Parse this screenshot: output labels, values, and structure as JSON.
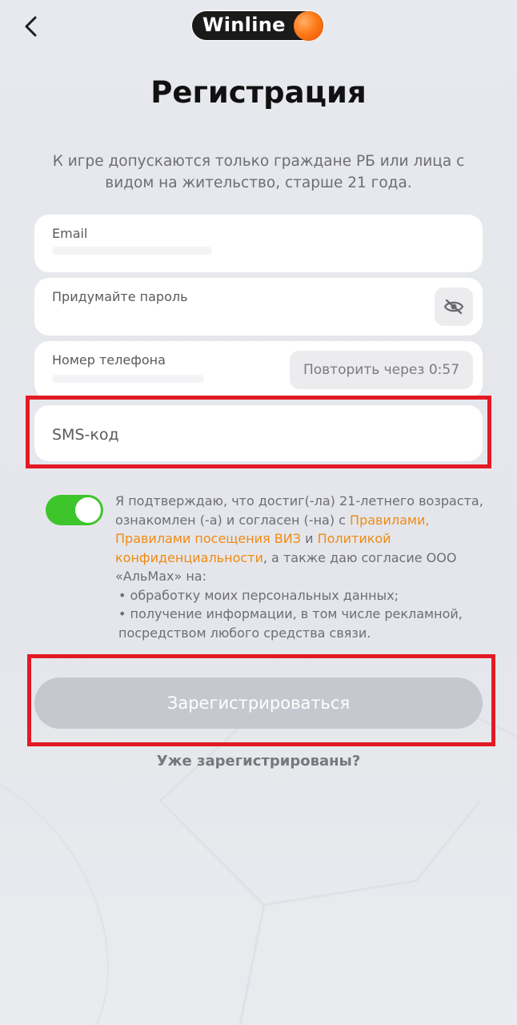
{
  "header": {
    "back_icon": "chevron-left-icon",
    "logo_text": "Winline",
    "logo_ball_color": "#ff7a1a"
  },
  "title": "Регистрация",
  "subtitle": "К игре допускаются только граждане РБ или лица с видом на жительство, старше 21 года.",
  "form": {
    "email_label": "Email",
    "password_label": "Придумайте пароль",
    "password_toggle_icon": "eye-off-icon",
    "phone_label": "Номер телефона",
    "resend_label": "Повторить через 0:57",
    "sms_placeholder": "SMS-код"
  },
  "consent": {
    "toggle_on": true,
    "text_1": "Я подтверждаю, что достиг(-ла) 21-летнего возраста, ознакомлен (-а) и согласен (-на) с ",
    "link_1": "Правилами, Правилами посещения ВИЗ",
    "text_2": " и ",
    "link_2": "Политикой конфиденциальности",
    "text_3": ",  а также даю согласие ООО «АльМах» на:",
    "bullet_1": "• обработку моих персональных данных;",
    "bullet_2": "• получение информации, в том числе рекламной, посредством любого средства связи."
  },
  "submit_label": "Зарегистрироваться",
  "login_link": "Уже зарегистрированы?",
  "colors": {
    "accent_orange": "#f08a12",
    "toggle_green": "#3ec52c",
    "highlight_red": "#e21a24",
    "button_disabled": "#c5c8cf"
  }
}
